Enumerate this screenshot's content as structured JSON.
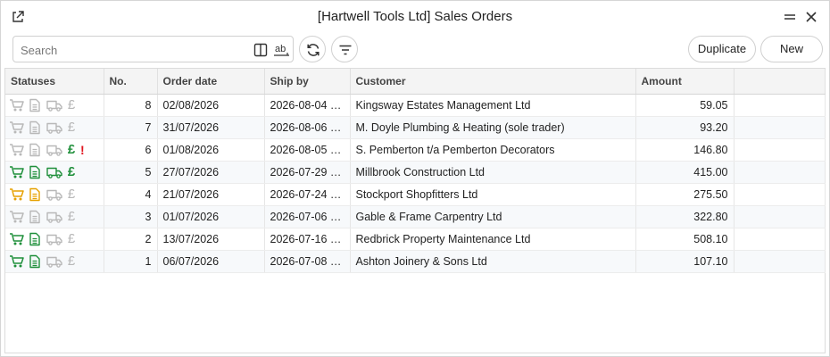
{
  "window": {
    "title": "[Hartwell Tools Ltd] Sales Orders"
  },
  "toolbar": {
    "search_placeholder": "Search",
    "duplicate_label": "Duplicate",
    "new_label": "New"
  },
  "colors": {
    "gray": "#b8b8b8",
    "green": "#1e8f3a",
    "amber": "#e6a100",
    "red": "#e0141e"
  },
  "columns": {
    "statuses": "Statuses",
    "no": "No.",
    "order_date": "Order date",
    "ship_by": "Ship by",
    "customer": "Customer",
    "amount": "Amount"
  },
  "rows": [
    {
      "no": "8",
      "order_date": "02/08/2026",
      "ship_by": "2026-08-04 0...",
      "customer": "Kingsway Estates Management Ltd",
      "amount": "59.05",
      "status": {
        "cart": "gray",
        "doc": "gray",
        "truck": "gray",
        "pound": "gray",
        "alert": ""
      }
    },
    {
      "no": "7",
      "order_date": "31/07/2026",
      "ship_by": "2026-08-06 0...",
      "customer": "M. Doyle Plumbing & Heating (sole trader)",
      "amount": "93.20",
      "status": {
        "cart": "gray",
        "doc": "gray",
        "truck": "gray",
        "pound": "gray",
        "alert": ""
      }
    },
    {
      "no": "6",
      "order_date": "01/08/2026",
      "ship_by": "2026-08-05 0...",
      "customer": "S. Pemberton t/a Pemberton Decorators",
      "amount": "146.80",
      "status": {
        "cart": "gray",
        "doc": "gray",
        "truck": "gray",
        "pound": "green",
        "alert": "!"
      }
    },
    {
      "no": "5",
      "order_date": "27/07/2026",
      "ship_by": "2026-07-29 0...",
      "customer": "Millbrook Construction Ltd",
      "amount": "415.00",
      "status": {
        "cart": "green",
        "doc": "green",
        "truck": "green",
        "pound": "green",
        "alert": ""
      }
    },
    {
      "no": "4",
      "order_date": "21/07/2026",
      "ship_by": "2026-07-24 0...",
      "customer": "Stockport Shopfitters Ltd",
      "amount": "275.50",
      "status": {
        "cart": "amber",
        "doc": "amber",
        "truck": "gray",
        "pound": "gray",
        "alert": ""
      }
    },
    {
      "no": "3",
      "order_date": "01/07/2026",
      "ship_by": "2026-07-06 0...",
      "customer": "Gable & Frame Carpentry Ltd",
      "amount": "322.80",
      "status": {
        "cart": "gray",
        "doc": "gray",
        "truck": "gray",
        "pound": "gray",
        "alert": ""
      }
    },
    {
      "no": "2",
      "order_date": "13/07/2026",
      "ship_by": "2026-07-16 0...",
      "customer": "Redbrick Property Maintenance Ltd",
      "amount": "508.10",
      "status": {
        "cart": "green",
        "doc": "green",
        "truck": "gray",
        "pound": "gray",
        "alert": ""
      }
    },
    {
      "no": "1",
      "order_date": "06/07/2026",
      "ship_by": "2026-07-08 0...",
      "customer": "Ashton Joinery & Sons Ltd",
      "amount": "107.10",
      "status": {
        "cart": "green",
        "doc": "green",
        "truck": "gray",
        "pound": "gray",
        "alert": ""
      }
    }
  ]
}
